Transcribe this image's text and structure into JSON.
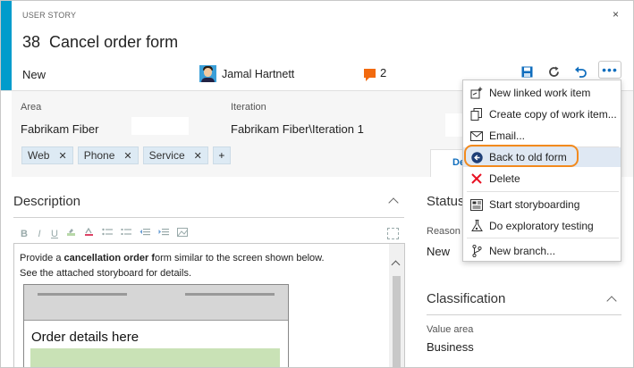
{
  "header": {
    "work_item_type": "USER STORY",
    "close_glyph": "×",
    "id": "38",
    "title": "Cancel order form",
    "state": "New",
    "assignee": "Jamal Hartnett",
    "comment_count": "2",
    "more_glyph": "•••"
  },
  "fields": {
    "area_label": "Area",
    "area_value": "Fabrikam Fiber",
    "iteration_label": "Iteration",
    "iteration_value": "Fabrikam Fiber\\Iteration 1"
  },
  "tags": [
    "Web",
    "Phone",
    "Service"
  ],
  "tag_remove_glyph": "✕",
  "tag_add_glyph": "+",
  "tab_partial": "De",
  "description": {
    "title": "Description",
    "toolbar": [
      "B",
      "I",
      "U"
    ],
    "line1_pre": "Provide a ",
    "line1_bold": "cancellation order f",
    "line1_post": "orm similar to the screen shown below.",
    "line2": "See the attached storyboard for details.",
    "mock_title": "Order details here"
  },
  "status": {
    "title": "Status",
    "reason_label": "Reason",
    "reason_value": "New"
  },
  "classification": {
    "title": "Classification",
    "value_area_label": "Value area",
    "value_area": "Business"
  },
  "menu": {
    "items": [
      {
        "label": "New linked work item",
        "icon": "new-linked-icon"
      },
      {
        "label": "Create copy of work item...",
        "icon": "copy-icon"
      },
      {
        "label": "Email...",
        "icon": "email-icon"
      },
      {
        "label": "Back to old form",
        "icon": "back-arrow-icon",
        "highlighted": true
      },
      {
        "label": "Delete",
        "icon": "delete-icon"
      },
      {
        "label": "Start storyboarding",
        "icon": "storyboard-icon"
      },
      {
        "label": "Do exploratory testing",
        "icon": "flask-icon"
      },
      {
        "label": "New branch...",
        "icon": "branch-icon"
      }
    ]
  },
  "colors": {
    "accent": "#009ccc",
    "highlight_ring": "#f28a1e",
    "menu_highlight": "#dfe8f3",
    "delete_red": "#e81123",
    "link_blue": "#106ebe",
    "comment_orange": "#f26a0f"
  }
}
